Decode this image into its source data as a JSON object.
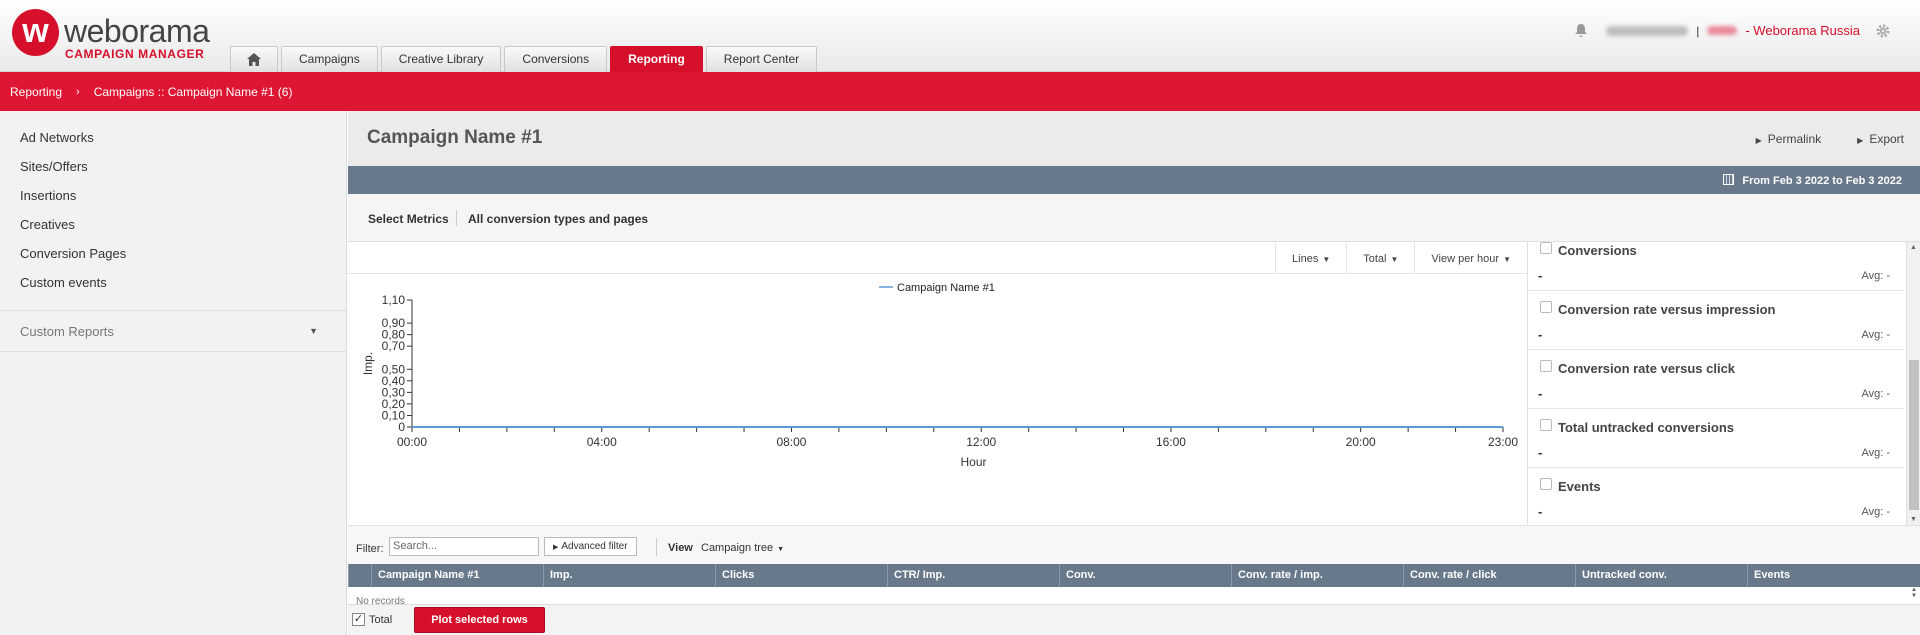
{
  "brand": {
    "logo_letter": "w",
    "name": "weborama",
    "subtitle": "CAMPAIGN MANAGER"
  },
  "tabs": [
    {
      "label": "Campaigns"
    },
    {
      "label": "Creative Library"
    },
    {
      "label": "Conversions"
    },
    {
      "label": "Reporting",
      "active": true
    },
    {
      "label": "Report Center"
    }
  ],
  "user": {
    "separator": "|",
    "company": "- Weborama Russia"
  },
  "breadcrumb": {
    "root": "Reporting",
    "current": "Campaigns :: Campaign Name #1 (6)"
  },
  "sidebar": {
    "items": [
      {
        "label": "Ad Networks"
      },
      {
        "label": "Sites/Offers"
      },
      {
        "label": "Insertions"
      },
      {
        "label": "Creatives"
      },
      {
        "label": "Conversion Pages"
      },
      {
        "label": "Custom events"
      }
    ],
    "custom_reports": "Custom Reports"
  },
  "main": {
    "title": "Campaign Name #1",
    "permalink": "Permalink",
    "export": "Export",
    "date_range": "From Feb 3 2022 to Feb 3 2022",
    "select_metrics": "Select Metrics",
    "conversion_filter": "All conversion types and pages"
  },
  "chart_controls": {
    "lines": "Lines",
    "total": "Total",
    "view": "View per hour"
  },
  "chart_data": {
    "type": "line",
    "ylabel": "Imp.",
    "xlabel": "Hour",
    "y_ticks": [
      "1,10",
      "0,90",
      "0,80",
      "0,70",
      "0,50",
      "0,40",
      "0,30",
      "0,20",
      "0,10",
      "0"
    ],
    "y_tick_values": [
      1.1,
      0.9,
      0.8,
      0.7,
      0.5,
      0.4,
      0.3,
      0.2,
      0.1,
      0
    ],
    "ylim": [
      0,
      1.1
    ],
    "x_ticks": [
      "00:00",
      "04:00",
      "08:00",
      "12:00",
      "16:00",
      "20:00",
      "23:00"
    ],
    "x_tick_hours": [
      0,
      4,
      8,
      12,
      16,
      20,
      23
    ],
    "xlim": [
      0,
      23
    ],
    "legend_position": "top-center",
    "series": [
      {
        "name": "Campaign Name #1",
        "color": "#5b9bd5",
        "x": [
          0,
          1,
          2,
          3,
          4,
          5,
          6,
          7,
          8,
          9,
          10,
          11,
          12,
          13,
          14,
          15,
          16,
          17,
          18,
          19,
          20,
          21,
          22,
          23
        ],
        "values": [
          0,
          0,
          0,
          0,
          0,
          0,
          0,
          0,
          0,
          0,
          0,
          0,
          0,
          0,
          0,
          0,
          0,
          0,
          0,
          0,
          0,
          0,
          0,
          0
        ]
      }
    ]
  },
  "metrics_panel": [
    {
      "label": "Conversions",
      "value": "-",
      "avg": "Avg: -"
    },
    {
      "label": "Conversion rate versus impression",
      "value": "-",
      "avg": "Avg: -"
    },
    {
      "label": "Conversion rate versus click",
      "value": "-",
      "avg": "Avg: -"
    },
    {
      "label": "Total untracked conversions",
      "value": "-",
      "avg": "Avg: -"
    },
    {
      "label": "Events",
      "value": "-",
      "avg": "Avg: -"
    }
  ],
  "filter": {
    "label": "Filter:",
    "search_placeholder": "Search...",
    "advanced": "Advanced filter",
    "view_label": "View",
    "view_value": "Campaign tree"
  },
  "table": {
    "columns": [
      "Campaign Name #1",
      "Imp.",
      "Clicks",
      "CTR/ Imp.",
      "Conv.",
      "Conv. rate / imp.",
      "Conv. rate / click",
      "Untracked conv.",
      "Events"
    ],
    "empty_text": "No records"
  },
  "bottom": {
    "total_label": "Total",
    "total_checked": true,
    "plot_button": "Plot selected rows"
  },
  "colors": {
    "brand_red": "#d60f2b",
    "header_slate": "#68798b",
    "series_line": "#5b9bd5"
  }
}
